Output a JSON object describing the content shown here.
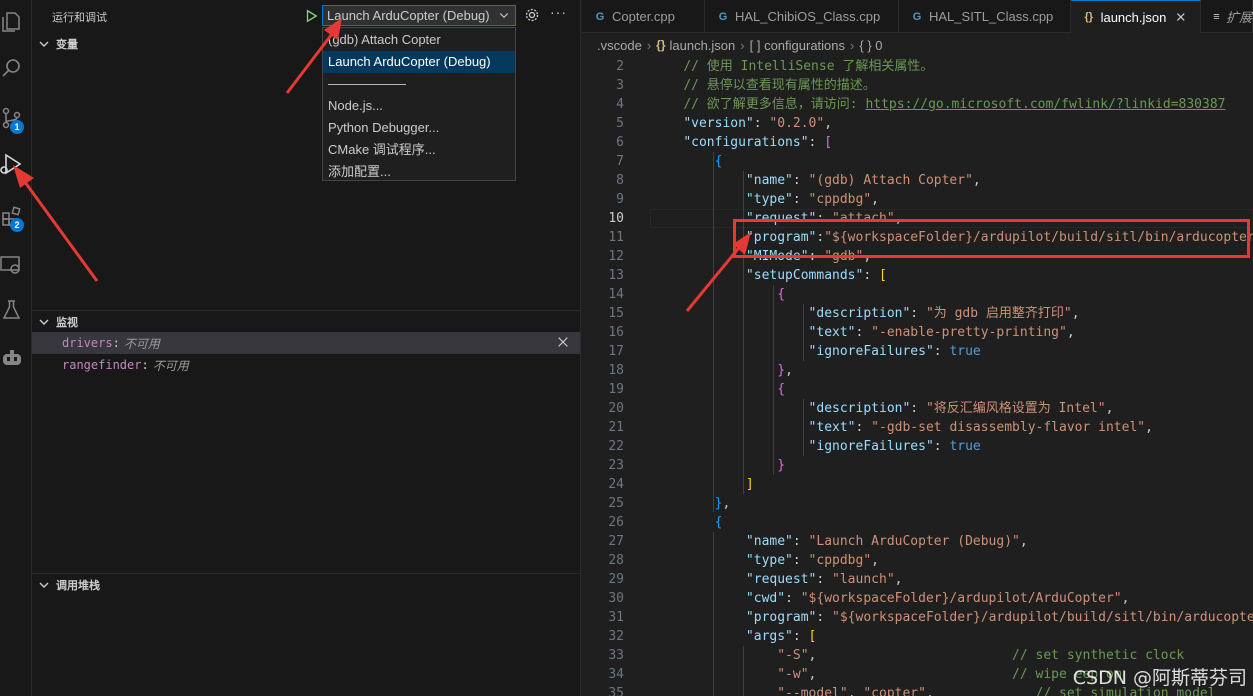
{
  "activity": {
    "items": [
      {
        "icon": "explorer-icon"
      },
      {
        "icon": "search-icon"
      },
      {
        "icon": "source-control-icon",
        "badge": "1"
      },
      {
        "icon": "run-debug-icon"
      },
      {
        "icon": "extensions-icon",
        "badge": "2"
      },
      {
        "icon": "remote-explorer-icon"
      },
      {
        "icon": "testing-icon"
      },
      {
        "icon": "copilot-icon"
      }
    ]
  },
  "sidebar": {
    "title": "运行和调试",
    "launch_config": "Launch ArduCopter (Debug)",
    "sections": {
      "variables": "变量",
      "watch": "监视",
      "callstack": "调用堆栈"
    },
    "watch_items": [
      {
        "name": "drivers",
        "value": "不可用"
      },
      {
        "name": "rangefinder",
        "value": "不可用"
      }
    ],
    "dropdown": {
      "items": [
        "(gdb) Attach Copter",
        "Launch ArduCopter (Debug)",
        "——————",
        "Node.js...",
        "Python Debugger...",
        "CMake 调试程序...",
        "添加配置..."
      ],
      "selected_index": 1
    }
  },
  "editor": {
    "tabs": [
      {
        "label": "Copter.cpp",
        "icon": "C++"
      },
      {
        "label": "HAL_ChibiOS_Class.cpp",
        "icon": "C++"
      },
      {
        "label": "HAL_SITL_Class.cpp",
        "icon": "C++"
      },
      {
        "label": "launch.json",
        "icon": "{}",
        "active": true
      },
      {
        "label": "扩展",
        "icon": "≡"
      }
    ],
    "breadcrumb": [
      ".vscode",
      "launch.json",
      "[ ] configurations",
      "{ } 0"
    ],
    "current_line": 10
  },
  "watermark": "CSDN @阿斯蒂芬司",
  "colors": {
    "accent": "#0078d4",
    "annotation_red": "#e53935"
  }
}
